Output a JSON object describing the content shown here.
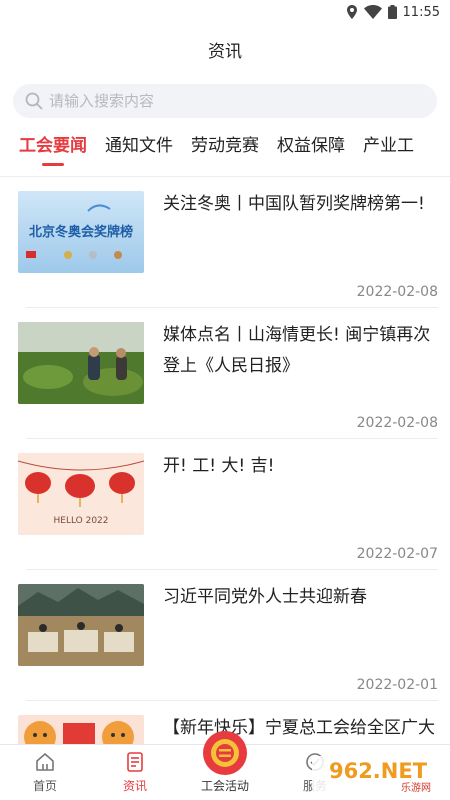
{
  "status_bar": {
    "time": "11:55"
  },
  "header": {
    "title": "资讯"
  },
  "search": {
    "placeholder": "请输入搜索内容"
  },
  "tabs": [
    {
      "label": "工会要闻",
      "active": true
    },
    {
      "label": "通知文件",
      "active": false
    },
    {
      "label": "劳动竞赛",
      "active": false
    },
    {
      "label": "权益保障",
      "active": false
    },
    {
      "label": "产业工",
      "active": false
    }
  ],
  "news": [
    {
      "title": "关注冬奥丨中国队暂列奖牌榜第一!",
      "date": "2022-02-08",
      "thumb_text": "北京冬奥会奖牌榜"
    },
    {
      "title": "媒体点名丨山海情更长! 闽宁镇再次登上《人民日报》",
      "date": "2022-02-08"
    },
    {
      "title": "开! 工! 大! 吉!",
      "date": "2022-02-07",
      "thumb_text": "HELLO 2022"
    },
    {
      "title": "习近平同党外人士共迎新春",
      "date": "2022-02-01"
    },
    {
      "title": "【新年快乐】宁夏总工会给全区广大职工群众拜年啦",
      "date": ""
    }
  ],
  "bottom_nav": [
    {
      "label": "首页",
      "active": false
    },
    {
      "label": "资讯",
      "active": true
    },
    {
      "label": "工会活动",
      "active": false
    },
    {
      "label": "服务",
      "active": false
    }
  ],
  "watermark": {
    "text": "962.NET",
    "subtext": "乐游网"
  },
  "colors": {
    "accent": "#e73b3f",
    "search_bg": "#f2f3f7",
    "date_text": "#888888"
  }
}
